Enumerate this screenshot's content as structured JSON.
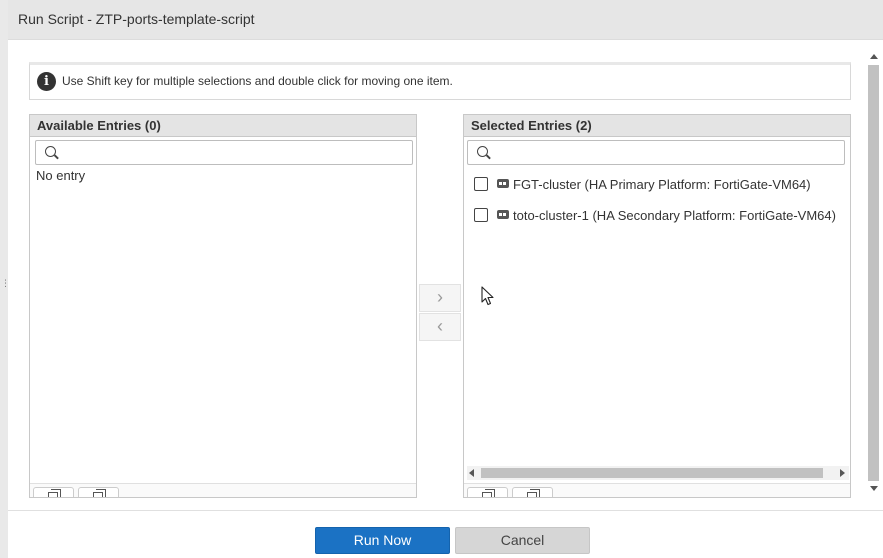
{
  "dialog": {
    "title": "Run Script - ZTP-ports-template-script"
  },
  "info": {
    "icon": "info-icon",
    "text": "Use Shift key for multiple selections and double click for moving one item."
  },
  "available": {
    "header": "Available Entries (0)",
    "search_value": "",
    "empty_text": "No entry"
  },
  "selected": {
    "header": "Selected Entries (2)",
    "search_value": "",
    "items": [
      {
        "label": "FGT-cluster (HA Primary Platform: FortiGate-VM64)",
        "checked": false,
        "icon": "ha-cluster-device-icon"
      },
      {
        "label": "toto-cluster-1 (HA Secondary Platform: FortiGate-VM64)",
        "checked": false,
        "icon": "ha-cluster-device-icon"
      }
    ]
  },
  "move_buttons": {
    "right": "›",
    "left": "‹"
  },
  "footer": {
    "run_label": "Run Now",
    "cancel_label": "Cancel"
  },
  "colors": {
    "primary": "#1b72c4",
    "secondary": "#d6d6d6",
    "header_bg": "#e4e4e4"
  }
}
